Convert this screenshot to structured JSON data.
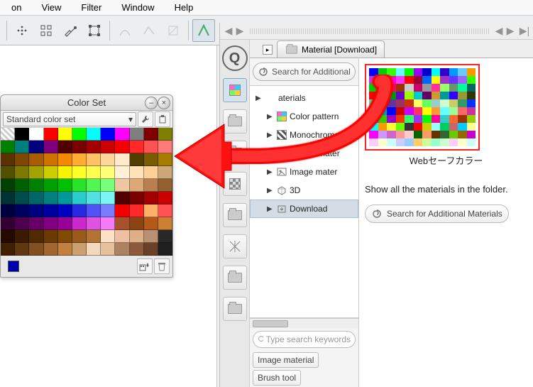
{
  "menu": {
    "items": [
      "on",
      "View",
      "Filter",
      "Window",
      "Help"
    ]
  },
  "color_set": {
    "title": "Color Set",
    "dropdown": "Standard color set",
    "rows": [
      [
        "trans",
        "#000000",
        "#ffffff",
        "#ff0000",
        "#ffff00",
        "#00ff00",
        "#00ffff",
        "#0000ff",
        "#ff00ff",
        "#7f7f7f",
        "#7f0000",
        "#7f7f00"
      ],
      [
        "#007f00",
        "#007f7f",
        "#00007f",
        "#7f007f",
        "#510000",
        "#7a0000",
        "#a30000",
        "#cc0000",
        "#f50000",
        "#ff2929",
        "#ff5252",
        "#ff7a7a"
      ],
      [
        "#593200",
        "#7f4700",
        "#a65d00",
        "#cc7300",
        "#f28900",
        "#ffad33",
        "#ffc266",
        "#ffd699",
        "#ffebcc",
        "#513e00",
        "#7a5d00",
        "#a37c00"
      ],
      [
        "#515100",
        "#7a7a00",
        "#a3a300",
        "#cccc00",
        "#f5f500",
        "#ffff29",
        "#ffff52",
        "#ffff7a",
        "#fff0d6",
        "#ffe2b8",
        "#ffcf98",
        "#cfa877"
      ],
      [
        "#004000",
        "#006000",
        "#008000",
        "#00a000",
        "#00c000",
        "#29e229",
        "#52f552",
        "#7aff7a",
        "#eec8a0",
        "#dca878",
        "#b88050",
        "#946030"
      ],
      [
        "#003333",
        "#004d4d",
        "#006666",
        "#008080",
        "#009999",
        "#29cccc",
        "#52e0e0",
        "#7af5f5",
        "#510000",
        "#7a0000",
        "#a30000",
        "#cc0000"
      ],
      [
        "#000040",
        "#000060",
        "#000080",
        "#0000a0",
        "#0000c0",
        "#2929e2",
        "#5252f5",
        "#7a7aff",
        "#f50000",
        "#ff2929",
        "#ffb266",
        "#ff5252"
      ],
      [
        "#330033",
        "#4d004d",
        "#660066",
        "#800080",
        "#990099",
        "#cc29cc",
        "#e052e0",
        "#f57af5",
        "#a6522d",
        "#8b4513",
        "#b35919",
        "#cd7f32"
      ],
      [
        "#220a00",
        "#3a1a00",
        "#522a00",
        "#6a3a00",
        "#824a00",
        "#9a5a1a",
        "#b27234",
        "#fce1c4",
        "#efbfa1",
        "#ddb088",
        "#bb8f72",
        "#282828"
      ],
      [
        "#402000",
        "#603810",
        "#805020",
        "#a06830",
        "#c08040",
        "#caa070",
        "#f2d9bd",
        "#e5c09a",
        "#ad8263",
        "#8b5a3a",
        "#6b4028",
        "#202020"
      ]
    ],
    "current": "#0000aa"
  },
  "material": {
    "tab_label": "Material [Download]",
    "search_label": "Search for Additional",
    "tree": [
      {
        "label": "aterials",
        "icon": "root",
        "indent": 0
      },
      {
        "label": "Color pattern",
        "icon": "color",
        "indent": 1
      },
      {
        "label": "Monochroma",
        "icon": "mono",
        "indent": 1
      },
      {
        "label": "Manga mater",
        "icon": "folder",
        "indent": 1
      },
      {
        "label": "Image mater",
        "icon": "image",
        "indent": 1
      },
      {
        "label": "3D",
        "icon": "3d",
        "indent": 1
      },
      {
        "label": "Download",
        "icon": "download",
        "indent": 1,
        "selected": true
      }
    ],
    "keyword_placeholder": "Type search keywords",
    "tags": [
      "Image material",
      "Brush tool"
    ],
    "item_caption": "Webセーフカラー",
    "list_message": "Show all the materials in the folder.",
    "search_more": "Search for Additional Materials",
    "thumb_rows": [
      [
        "#00f",
        "#0c0",
        "#3f0",
        "#6ff",
        "#0f0",
        "#90f",
        "#00c",
        "#0ff",
        "#30c",
        "#09f",
        "#6cf",
        "#f90"
      ],
      [
        "#c3c",
        "#00f",
        "#f0c",
        "#f3f",
        "#f00",
        "#903",
        "#06f",
        "#ff0",
        "#93c",
        "#63f",
        "#96f",
        "#3f0"
      ],
      [
        "#0c0",
        "#cf3",
        "#f06",
        "#930",
        "#ccc",
        "#c06",
        "#999",
        "#f39",
        "#9f6",
        "#696",
        "#0f9",
        "#066"
      ],
      [
        "#f00",
        "#6f3",
        "#090",
        "#60c",
        "#9f0",
        "#0cc",
        "#606",
        "#c93",
        "#099",
        "#30f",
        "#993",
        "#330"
      ],
      [
        "#6c9",
        "#336",
        "#639",
        "#936",
        "#c30",
        "#ff6",
        "#6f6",
        "#9cc",
        "#cfc",
        "#cc6",
        "#396",
        "#03f"
      ],
      [
        "#fc9",
        "#09c",
        "#00f",
        "#c00",
        "#c0f",
        "#f36",
        "#ff0",
        "#f93",
        "#6ff",
        "#9f9",
        "#f66",
        "#c39"
      ],
      [
        "#f0f",
        "#3c0",
        "#90c",
        "#f30",
        "#3f6",
        "#93f",
        "#0f0",
        "#f09",
        "#3cc",
        "#f63",
        "#930",
        "#9c0"
      ],
      [
        "#0ff",
        "#f90",
        "#ff3",
        "#6f0",
        "#333",
        "#f00",
        "#cc0",
        "#9ff",
        "#0c6",
        "#c66",
        "#0cf",
        "#ff9"
      ],
      [
        "#f0f",
        "#c9f",
        "#c6c",
        "#f99",
        "#fcc",
        "#060",
        "#f96",
        "#630",
        "#363",
        "#6c0",
        "#960",
        "#c0c"
      ],
      [
        "#fcf",
        "#ffc",
        "#cff",
        "#ccf",
        "#9cf",
        "#fc6",
        "#cf9",
        "#9fc",
        "#cfc",
        "#fcf",
        "#ffc",
        "#cff"
      ]
    ]
  }
}
